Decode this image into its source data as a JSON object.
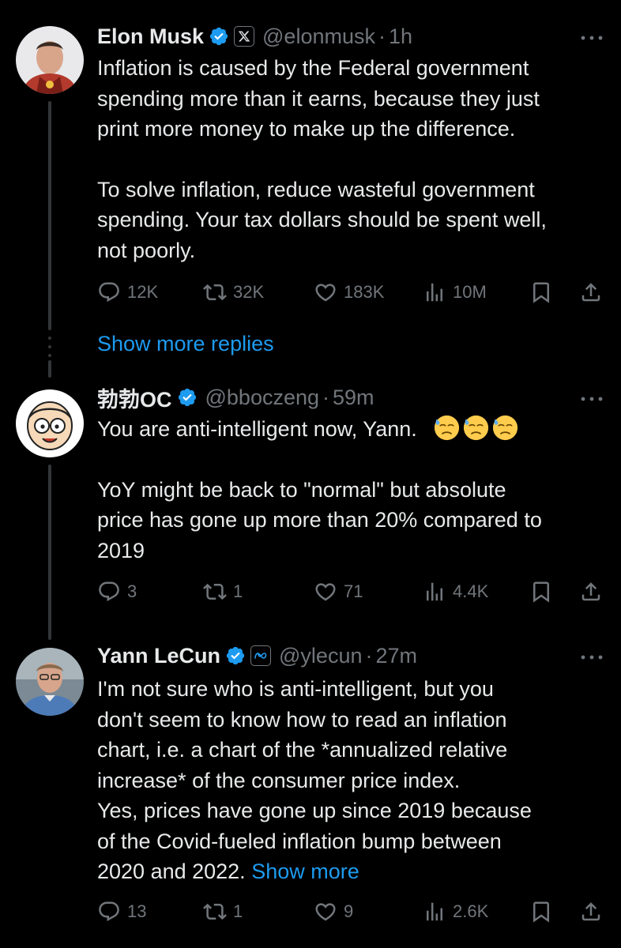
{
  "tweets": [
    {
      "name": "Elon Musk",
      "handle": "@elonmusk",
      "dot": "·",
      "time": "1h",
      "badge_icon": "x-logo-icon",
      "body": [
        "Inflation is caused by the Federal government",
        "spending more than it earns, because they just",
        "print more money to make up the difference.",
        "",
        "To solve inflation, reduce wasteful government",
        "spending. Your tax dollars should be spent well,",
        "not poorly."
      ],
      "stats": {
        "replies": "12K",
        "reposts": "32K",
        "likes": "183K",
        "views": "10M"
      }
    },
    {
      "name": "勃勃OC",
      "handle": "@bboczeng",
      "dot": "·",
      "time": "59m",
      "body_first": "You are anti-intelligent now, Yann.",
      "emoji_icon": "downcast-face-with-sweat-icon",
      "body": [
        "",
        "YoY might be back to \"normal\" but absolute",
        "price has gone up more than 20% compared to",
        "2019"
      ],
      "stats": {
        "replies": "3",
        "reposts": "1",
        "likes": "71",
        "views": "4.4K"
      }
    },
    {
      "name": "Yann LeCun",
      "handle": "@ylecun",
      "dot": "·",
      "time": "27m",
      "badge_icon": "meta-logo-icon",
      "body": [
        "I'm not sure who is anti-intelligent, but you",
        "don't seem to know how to read an inflation",
        "chart, i.e. a chart of the *annualized relative",
        "increase* of the consumer price index.",
        "Yes, prices have gone up since 2019 because",
        "of the Covid-fueled inflation bump between"
      ],
      "body_last": "2020 and 2022.",
      "show_more": "Show more",
      "stats": {
        "replies": "13",
        "reposts": "1",
        "likes": "9",
        "views": "2.6K"
      }
    }
  ],
  "show_more_replies": "Show more replies",
  "colors": {
    "accent": "#1d9bf0",
    "muted": "#71767b",
    "text": "#e7e9ea",
    "background": "#000000"
  }
}
